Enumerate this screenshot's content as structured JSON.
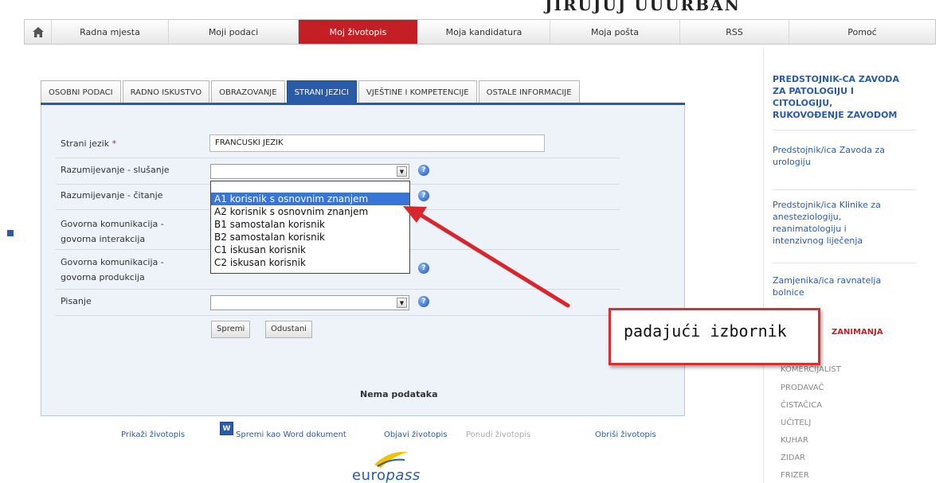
{
  "header": {
    "logo_text": "JIRUJUJ UUURBAN"
  },
  "nav": {
    "items": [
      {
        "label": "Radna mjesta"
      },
      {
        "label": "Moji podaci"
      },
      {
        "label": "Moj životopis"
      },
      {
        "label": "Moja kandidatura"
      },
      {
        "label": "Moja pošta"
      },
      {
        "label": "RSS"
      },
      {
        "label": "Pomoć"
      }
    ],
    "active_index": 2
  },
  "tabs": [
    {
      "label": "OSOBNI PODACI"
    },
    {
      "label": "RADNO ISKUSTVO"
    },
    {
      "label": "OBRAZOVANJE"
    },
    {
      "label": "STRANI JEZICI"
    },
    {
      "label": "VJEŠTINE I KOMPETENCIJE"
    },
    {
      "label": "OSTALE INFORMACIJE"
    }
  ],
  "form": {
    "strani_jezik": {
      "label": "Strani jezik",
      "required_mark": "*",
      "value": "FRANCUSKI JEZIK"
    },
    "slusanje": {
      "label": "Razumijevanje - slušanje"
    },
    "citanje": {
      "label": "Razumijevanje - čitanje"
    },
    "interakcija": {
      "label_line1": "Govorna komunikacija -",
      "label_line2": "govorna interakcija"
    },
    "produkcija": {
      "label_line1": "Govorna komunikacija -",
      "label_line2": "govorna produkcija"
    },
    "pisanje": {
      "label": "Pisanje"
    },
    "help_glyph": "?",
    "dropdown_options": [
      {
        "label": ""
      },
      {
        "label": "A1 korisnik s osnovnim znanjem"
      },
      {
        "label": "A2 korisnik s osnovnim znanjem"
      },
      {
        "label": "B1 samostalan korisnik"
      },
      {
        "label": "B2 samostalan korisnik"
      },
      {
        "label": "C1 iskusan korisnik"
      },
      {
        "label": "C2 iskusan korisnik"
      }
    ],
    "highlighted_option_index": 1,
    "save_label": "Spremi",
    "cancel_label": "Odustani",
    "empty_text": "Nema podataka"
  },
  "actions": {
    "show": "Prikaži životopis",
    "word_icon_glyph": "W",
    "save_word": "Spremi kao Word dokument",
    "publish": "Objavi životopis",
    "offer": "Ponudi životopis",
    "delete": "Obriši životopis"
  },
  "europass": {
    "prefix": "euro",
    "suffix": "pass"
  },
  "sidebar": {
    "jobs": [
      {
        "line1": "PREDSTOJNIK-CA ZAVODA",
        "line2": "ZA PATOLOGIJU I",
        "line3": "CITOLOGIJU,",
        "line4": "RUKOVOĐENJE ZAVODOM"
      },
      {
        "line1": "Predstojnik/ica Zavoda za",
        "line2": "urologiju"
      },
      {
        "line1": "Predstojnik/ica Klinike za",
        "line2": "anesteziologiju,",
        "line3": "reanimatologiju i",
        "line4": "intenzivnog liječenja"
      },
      {
        "line1": "Zamjenika/ica ravnatelja",
        "line2": "bolnice"
      }
    ],
    "zanimanja_label": "ZANIMANJA",
    "occupations": [
      "KOMERCIJALIST",
      "PRODAVAČ",
      "ČISTAČICA",
      "UČITELJ",
      "KUHAR",
      "ZIDAR",
      "FRIZER"
    ]
  },
  "annotation": {
    "callout_text": "padajući izbornik",
    "color": "#e32b2b"
  },
  "colors": {
    "brand_red": "#c41f25",
    "tab_blue": "#2a5ba8",
    "highlight_blue": "#3875d7"
  }
}
